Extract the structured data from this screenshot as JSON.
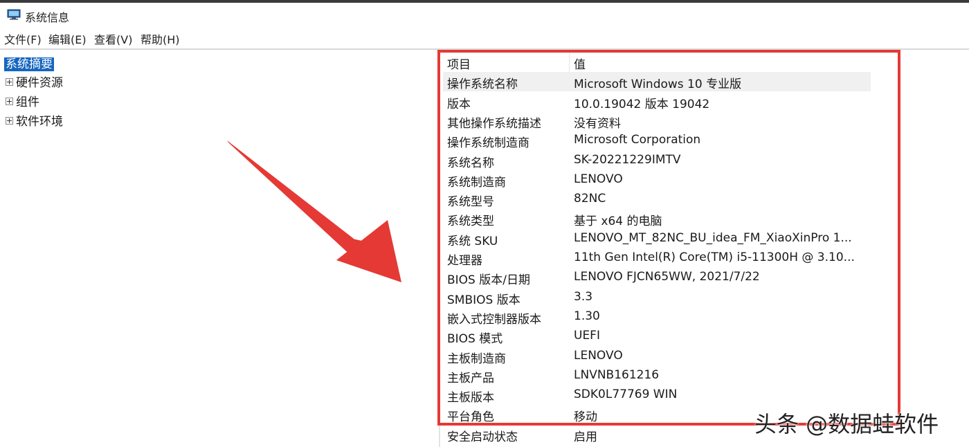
{
  "window": {
    "title": "系统信息"
  },
  "menu": [
    "文件(F)",
    "编辑(E)",
    "查看(V)",
    "帮助(H)"
  ],
  "tree": {
    "selected": "系统摘要",
    "nodes": [
      "硬件资源",
      "组件",
      "软件环境"
    ]
  },
  "table": {
    "headers": {
      "item": "项目",
      "value": "值"
    },
    "rows": [
      {
        "item": "操作系统名称",
        "value": "Microsoft Windows 10 专业版"
      },
      {
        "item": "版本",
        "value": "10.0.19042 版本 19042"
      },
      {
        "item": "其他操作系统描述",
        "value": "没有资料"
      },
      {
        "item": "操作系统制造商",
        "value": "Microsoft Corporation"
      },
      {
        "item": "系统名称",
        "value": "SK-20221229IMTV"
      },
      {
        "item": "系统制造商",
        "value": "LENOVO"
      },
      {
        "item": "系统型号",
        "value": "82NC"
      },
      {
        "item": "系统类型",
        "value": "基于 x64 的电脑"
      },
      {
        "item": "系统 SKU",
        "value": "LENOVO_MT_82NC_BU_idea_FM_XiaoXinPro 1..."
      },
      {
        "item": "处理器",
        "value": "11th Gen Intel(R) Core(TM) i5-11300H @ 3.10..."
      },
      {
        "item": "BIOS 版本/日期",
        "value": "LENOVO FJCN65WW, 2021/7/22"
      },
      {
        "item": "SMBIOS 版本",
        "value": "3.3"
      },
      {
        "item": "嵌入式控制器版本",
        "value": "1.30"
      },
      {
        "item": "BIOS 模式",
        "value": "UEFI"
      },
      {
        "item": "主板制造商",
        "value": "LENOVO"
      },
      {
        "item": "主板产品",
        "value": "LNVNB161216"
      },
      {
        "item": "主板版本",
        "value": "SDK0L77769 WIN"
      },
      {
        "item": "平台角色",
        "value": "移动"
      },
      {
        "item": "安全启动状态",
        "value": "启用"
      }
    ]
  },
  "watermark": "头条 @数据蛙软件",
  "colors": {
    "highlight_box": "#e53935",
    "selection": "#1565c0"
  },
  "icons": {
    "app": "system-info-icon",
    "expander": "plus-expander-icon",
    "arrow": "red-arrow-icon"
  }
}
